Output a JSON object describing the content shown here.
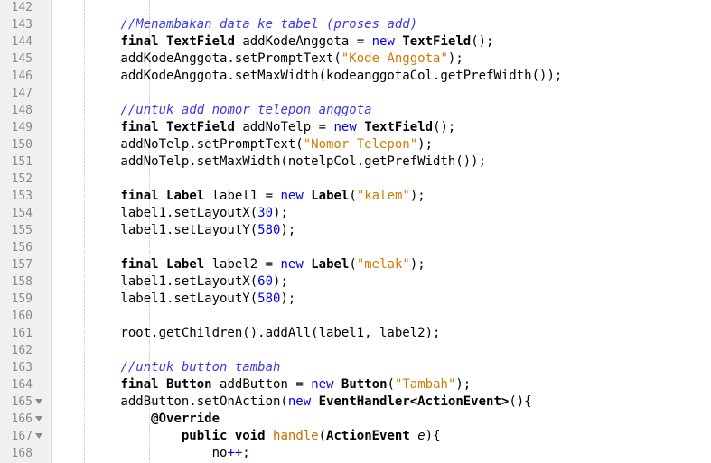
{
  "editor": {
    "lines": [
      {
        "n": "142",
        "segs": []
      },
      {
        "n": "143",
        "segs": [
          {
            "t": "        "
          },
          {
            "t": "//Menambakan data ke tabel (proses add)",
            "c": "cmt"
          }
        ]
      },
      {
        "n": "144",
        "segs": [
          {
            "t": "        "
          },
          {
            "t": "final",
            "c": "kwb"
          },
          {
            "t": " "
          },
          {
            "t": "TextField",
            "c": "kwb"
          },
          {
            "t": " addKodeAnggota = "
          },
          {
            "t": "new",
            "c": "kw"
          },
          {
            "t": " "
          },
          {
            "t": "TextField",
            "c": "kwb"
          },
          {
            "t": "();"
          }
        ]
      },
      {
        "n": "145",
        "segs": [
          {
            "t": "        addKodeAnggota.setPromptText("
          },
          {
            "t": "\"Kode Anggota\"",
            "c": "str"
          },
          {
            "t": ");"
          }
        ]
      },
      {
        "n": "146",
        "segs": [
          {
            "t": "        addKodeAnggota.setMaxWidth(kodeanggotaCol.getPrefWidth());"
          }
        ]
      },
      {
        "n": "147",
        "segs": []
      },
      {
        "n": "148",
        "segs": [
          {
            "t": "        "
          },
          {
            "t": "//untuk add nomor telepon anggota",
            "c": "cmt"
          }
        ]
      },
      {
        "n": "149",
        "segs": [
          {
            "t": "        "
          },
          {
            "t": "final",
            "c": "kwb"
          },
          {
            "t": " "
          },
          {
            "t": "TextField",
            "c": "kwb"
          },
          {
            "t": " addNoTelp = "
          },
          {
            "t": "new",
            "c": "kw"
          },
          {
            "t": " "
          },
          {
            "t": "TextField",
            "c": "kwb"
          },
          {
            "t": "();"
          }
        ]
      },
      {
        "n": "150",
        "segs": [
          {
            "t": "        addNoTelp.setPromptText("
          },
          {
            "t": "\"Nomor Telepon\"",
            "c": "str"
          },
          {
            "t": ");"
          }
        ]
      },
      {
        "n": "151",
        "segs": [
          {
            "t": "        addNoTelp.setMaxWidth(notelpCol.getPrefWidth());"
          }
        ]
      },
      {
        "n": "152",
        "segs": []
      },
      {
        "n": "153",
        "segs": [
          {
            "t": "        "
          },
          {
            "t": "final",
            "c": "kwb"
          },
          {
            "t": " "
          },
          {
            "t": "Label",
            "c": "kwb"
          },
          {
            "t": " label1 = "
          },
          {
            "t": "new",
            "c": "kw"
          },
          {
            "t": " "
          },
          {
            "t": "Label",
            "c": "kwb"
          },
          {
            "t": "("
          },
          {
            "t": "\"kalem\"",
            "c": "str"
          },
          {
            "t": ");"
          }
        ]
      },
      {
        "n": "154",
        "segs": [
          {
            "t": "        label1.setLayoutX("
          },
          {
            "t": "30",
            "c": "num"
          },
          {
            "t": ");"
          }
        ]
      },
      {
        "n": "155",
        "segs": [
          {
            "t": "        label1.setLayoutY("
          },
          {
            "t": "580",
            "c": "num"
          },
          {
            "t": ");"
          }
        ]
      },
      {
        "n": "156",
        "segs": []
      },
      {
        "n": "157",
        "segs": [
          {
            "t": "        "
          },
          {
            "t": "final",
            "c": "kwb"
          },
          {
            "t": " "
          },
          {
            "t": "Label",
            "c": "kwb"
          },
          {
            "t": " label2 = "
          },
          {
            "t": "new",
            "c": "kw"
          },
          {
            "t": " "
          },
          {
            "t": "Label",
            "c": "kwb"
          },
          {
            "t": "("
          },
          {
            "t": "\"melak\"",
            "c": "str"
          },
          {
            "t": ");"
          }
        ]
      },
      {
        "n": "158",
        "segs": [
          {
            "t": "        label1.setLayoutX("
          },
          {
            "t": "60",
            "c": "num"
          },
          {
            "t": ");"
          }
        ]
      },
      {
        "n": "159",
        "segs": [
          {
            "t": "        label1.setLayoutY("
          },
          {
            "t": "580",
            "c": "num"
          },
          {
            "t": ");"
          }
        ]
      },
      {
        "n": "160",
        "segs": []
      },
      {
        "n": "161",
        "segs": [
          {
            "t": "        root.getChildren().addAll(label1, label2);"
          }
        ]
      },
      {
        "n": "162",
        "segs": []
      },
      {
        "n": "163",
        "segs": [
          {
            "t": "        "
          },
          {
            "t": "//untuk button tambah",
            "c": "cmt"
          }
        ]
      },
      {
        "n": "164",
        "segs": [
          {
            "t": "        "
          },
          {
            "t": "final",
            "c": "kwb"
          },
          {
            "t": " "
          },
          {
            "t": "Button",
            "c": "kwb"
          },
          {
            "t": " addButton = "
          },
          {
            "t": "new",
            "c": "kw"
          },
          {
            "t": " "
          },
          {
            "t": "Button",
            "c": "kwb"
          },
          {
            "t": "("
          },
          {
            "t": "\"Tambah\"",
            "c": "str"
          },
          {
            "t": ");"
          }
        ]
      },
      {
        "n": "165",
        "fold": true,
        "segs": [
          {
            "t": "        addButton.setOnAction("
          },
          {
            "t": "new",
            "c": "kw"
          },
          {
            "t": " "
          },
          {
            "t": "EventHandler<ActionEvent>",
            "c": "kwb"
          },
          {
            "t": "(){"
          }
        ]
      },
      {
        "n": "166",
        "fold": true,
        "segs": [
          {
            "t": "            "
          },
          {
            "t": "@Override",
            "c": "ann"
          }
        ]
      },
      {
        "n": "167",
        "fold": true,
        "segs": [
          {
            "t": "                "
          },
          {
            "t": "public",
            "c": "kwb"
          },
          {
            "t": " "
          },
          {
            "t": "void",
            "c": "kwb"
          },
          {
            "t": " "
          },
          {
            "t": "handle",
            "c": "meth"
          },
          {
            "t": "("
          },
          {
            "t": "ActionEvent",
            "c": "kwb"
          },
          {
            "t": " "
          },
          {
            "t": "e",
            "c": "param"
          },
          {
            "t": "){"
          }
        ]
      },
      {
        "n": "168",
        "segs": [
          {
            "t": "                    no"
          },
          {
            "t": "++",
            "c": "kw"
          },
          {
            "t": ";"
          }
        ]
      }
    ]
  }
}
